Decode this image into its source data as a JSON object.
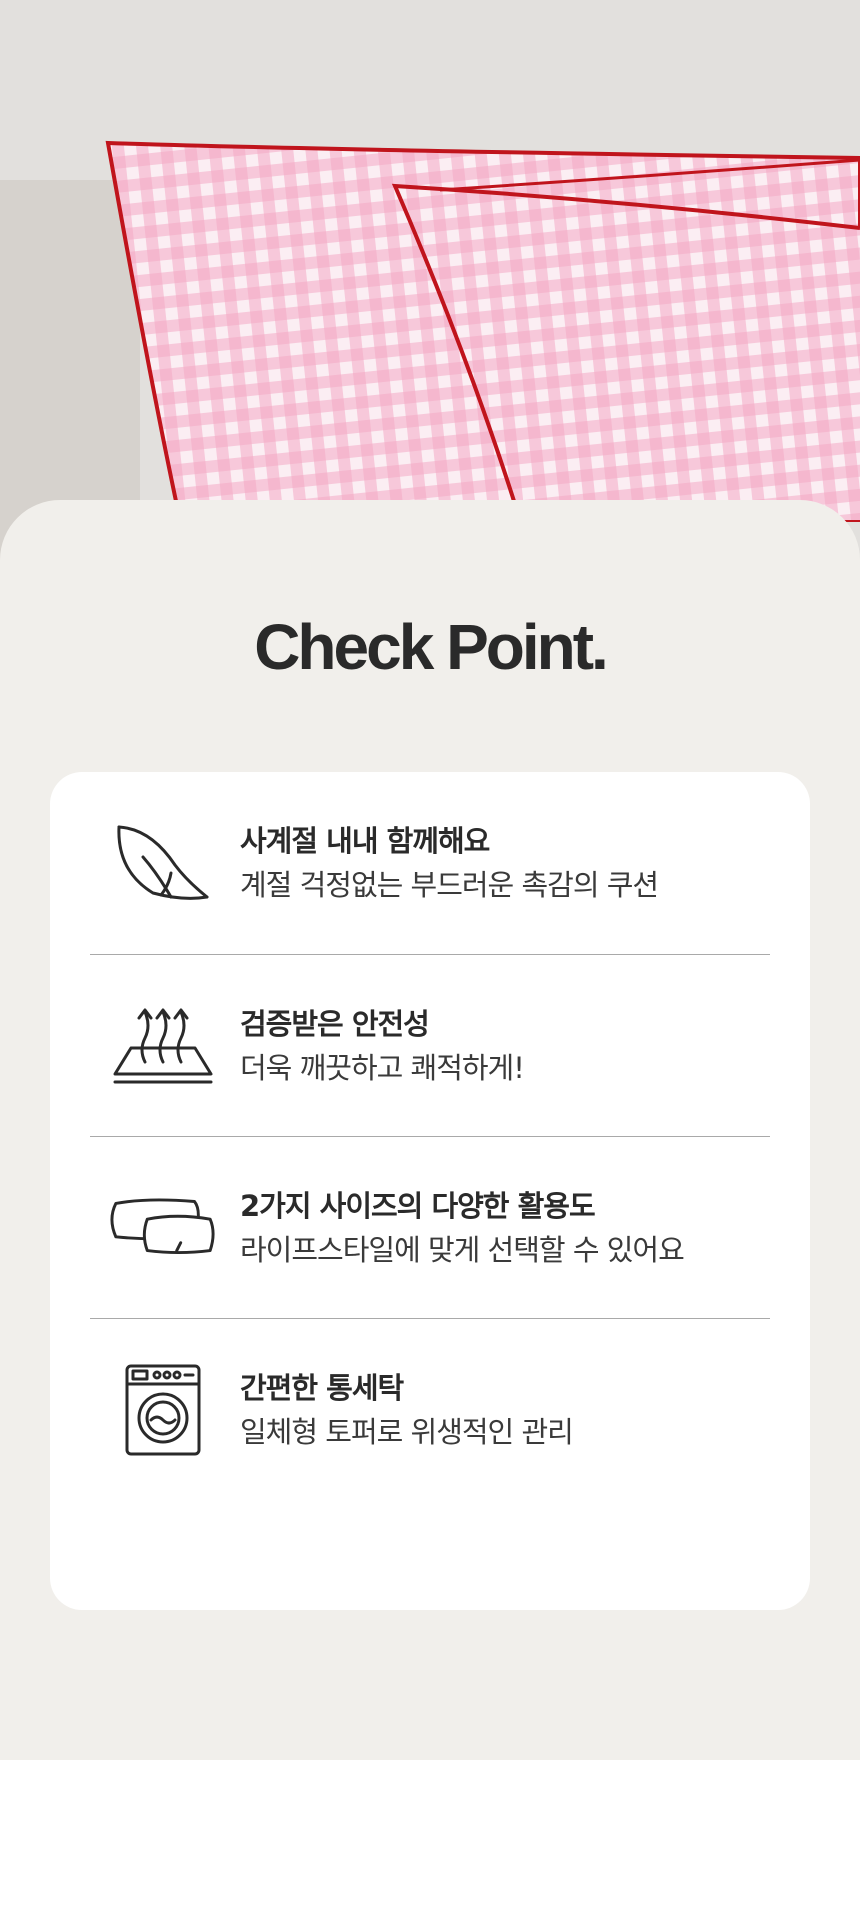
{
  "page": {
    "background": "#ffffff",
    "panel_color": "#f1efeb",
    "card_color": "#ffffff",
    "text_color": "#2a2a2a",
    "divider_color": "#a9a9a9"
  },
  "hero": {
    "pillow_pattern_color": "#f4a9c4",
    "piping_color": "#c0141c"
  },
  "section": {
    "title": "Check Point."
  },
  "features": [
    {
      "icon": "feather-icon",
      "title": "사계절 내내 함께해요",
      "description": "계절 걱정없는 부드러운 촉감의 쿠션"
    },
    {
      "icon": "breathable-layer-icon",
      "title": "검증받은 안전성",
      "description": "더욱 깨끗하고 쾌적하게!"
    },
    {
      "icon": "cushions-icon",
      "title": "2가지 사이즈의 다양한 활용도",
      "description": "라이프스타일에 맞게 선택할 수 있어요"
    },
    {
      "icon": "washing-machine-icon",
      "title": "간편한 통세탁",
      "description": "일체형 토퍼로 위생적인 관리"
    }
  ]
}
